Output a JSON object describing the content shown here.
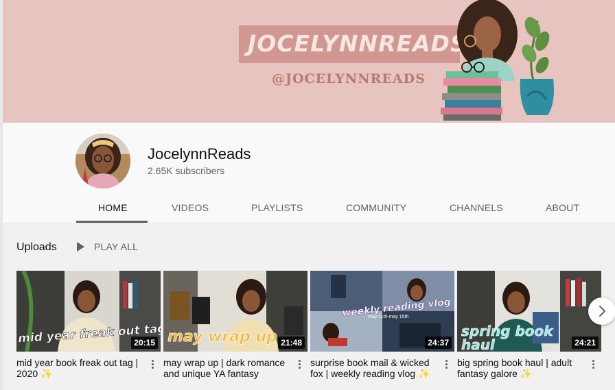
{
  "banner": {
    "title": "JOCELYNNREADS",
    "handle": "@JOCELYNNREADS"
  },
  "channel": {
    "name": "JocelynnReads",
    "subscribers": "2.65K subscribers"
  },
  "tabs": [
    {
      "label": "HOME",
      "active": true
    },
    {
      "label": "VIDEOS",
      "active": false
    },
    {
      "label": "PLAYLISTS",
      "active": false
    },
    {
      "label": "COMMUNITY",
      "active": false
    },
    {
      "label": "CHANNELS",
      "active": false
    },
    {
      "label": "ABOUT",
      "active": false
    }
  ],
  "uploads": {
    "heading": "Uploads",
    "play_all": "PLAY ALL"
  },
  "videos": [
    {
      "title": "mid year book freak out tag | 2020",
      "duration": "20:15",
      "thumb_text": "mid year freak out tag"
    },
    {
      "title": "may wrap up | dark romance and unique YA fantasy",
      "duration": "21:48",
      "thumb_text": "may wrap up"
    },
    {
      "title": "surprise book mail & wicked fox | weekly reading vlog",
      "duration": "24:37",
      "thumb_text": "weekly reading vlog",
      "thumb_subtext": "may 11th-may 15th"
    },
    {
      "title": "big spring book haul | adult fantasy galore",
      "duration": "24:21",
      "thumb_text": "spring book haul"
    }
  ],
  "sparkle": "✨",
  "colors": {
    "banner_bg": "#e7c4bf",
    "banner_pill": "#d09890",
    "text_primary": "#0f0f0f",
    "text_secondary": "#606060"
  },
  "icons": [
    "play-icon",
    "more-vert-icon",
    "chevron-right-icon"
  ]
}
